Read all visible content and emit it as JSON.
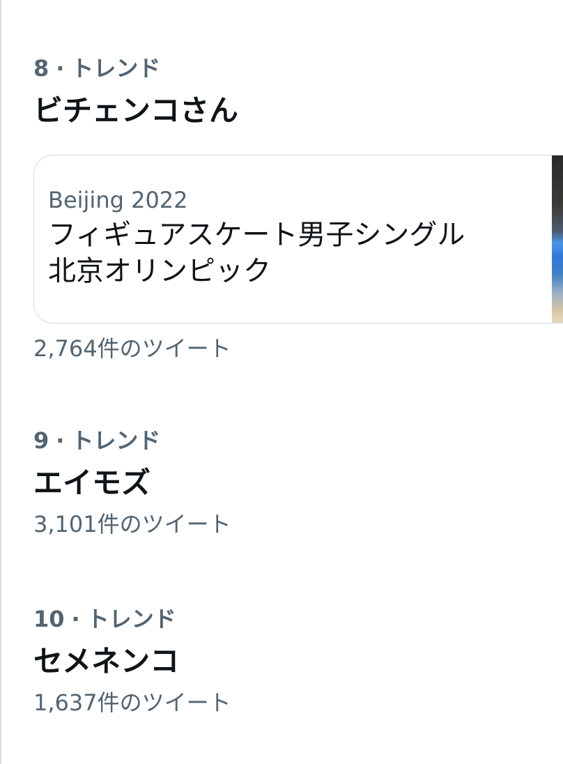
{
  "trends": [
    {
      "rank": "8",
      "separator": "·",
      "label": "トレンド",
      "title": "ビチェンコさん",
      "card": {
        "source": "Beijing 2022",
        "headline_line1": "フィギュアスケート男子シングル",
        "headline_line2": "北京オリンピック"
      },
      "tweet_count": "2,764件のツイート"
    },
    {
      "rank": "9",
      "separator": "·",
      "label": "トレンド",
      "title": "エイモズ",
      "tweet_count": "3,101件のツイート"
    },
    {
      "rank": "10",
      "separator": "·",
      "label": "トレンド",
      "title": "セメネンコ",
      "tweet_count": "1,637件のツイート"
    }
  ],
  "colors": {
    "primary_text": "#0f1419",
    "secondary_text": "#536471",
    "card_border": "#cfd9de"
  }
}
